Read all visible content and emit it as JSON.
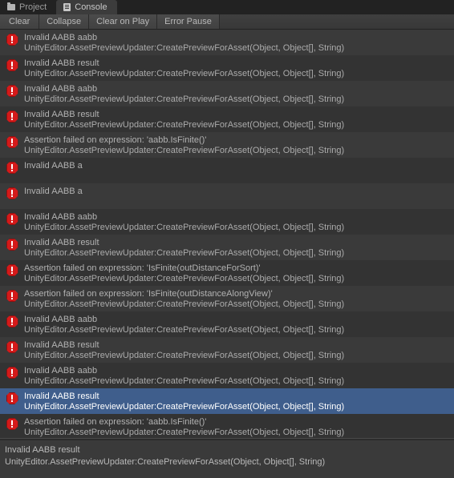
{
  "window": {
    "tabs": [
      {
        "label": "Project",
        "icon": "folder-icon",
        "active": false
      },
      {
        "label": "Console",
        "icon": "console-icon",
        "active": true
      }
    ]
  },
  "toolbar": {
    "buttons": [
      {
        "label": "Clear"
      },
      {
        "label": "Collapse"
      },
      {
        "label": "Clear on Play"
      },
      {
        "label": "Error Pause"
      }
    ]
  },
  "colors": {
    "window_bg": "#383838",
    "tabbar_bg": "#222222",
    "row_even": "#3a3a3a",
    "row_odd": "#333333",
    "selection": "#3f5e8c",
    "error_icon": "#d41a1a",
    "text": "#b2b2b2",
    "selected_text": "#ffffff"
  },
  "console": {
    "entries": [
      {
        "icon": "error-icon",
        "message": "Invalid AABB aabb",
        "stacktrace": "UnityEditor.AssetPreviewUpdater:CreatePreviewForAsset(Object, Object[], String)",
        "selected": false
      },
      {
        "icon": "error-icon",
        "message": "Invalid AABB result",
        "stacktrace": "UnityEditor.AssetPreviewUpdater:CreatePreviewForAsset(Object, Object[], String)",
        "selected": false
      },
      {
        "icon": "error-icon",
        "message": "Invalid AABB aabb",
        "stacktrace": "UnityEditor.AssetPreviewUpdater:CreatePreviewForAsset(Object, Object[], String)",
        "selected": false
      },
      {
        "icon": "error-icon",
        "message": "Invalid AABB result",
        "stacktrace": "UnityEditor.AssetPreviewUpdater:CreatePreviewForAsset(Object, Object[], String)",
        "selected": false
      },
      {
        "icon": "error-icon",
        "message": "Assertion failed on expression: 'aabb.IsFinite()'",
        "stacktrace": "UnityEditor.AssetPreviewUpdater:CreatePreviewForAsset(Object, Object[], String)",
        "selected": false
      },
      {
        "icon": "error-icon",
        "message": "Invalid AABB a",
        "stacktrace": "",
        "selected": false
      },
      {
        "icon": "error-icon",
        "message": "Invalid AABB a",
        "stacktrace": "",
        "selected": false
      },
      {
        "icon": "error-icon",
        "message": "Invalid AABB aabb",
        "stacktrace": "UnityEditor.AssetPreviewUpdater:CreatePreviewForAsset(Object, Object[], String)",
        "selected": false
      },
      {
        "icon": "error-icon",
        "message": "Invalid AABB result",
        "stacktrace": "UnityEditor.AssetPreviewUpdater:CreatePreviewForAsset(Object, Object[], String)",
        "selected": false
      },
      {
        "icon": "error-icon",
        "message": "Assertion failed on expression: 'IsFinite(outDistanceForSort)'",
        "stacktrace": "UnityEditor.AssetPreviewUpdater:CreatePreviewForAsset(Object, Object[], String)",
        "selected": false
      },
      {
        "icon": "error-icon",
        "message": "Assertion failed on expression: 'IsFinite(outDistanceAlongView)'",
        "stacktrace": "UnityEditor.AssetPreviewUpdater:CreatePreviewForAsset(Object, Object[], String)",
        "selected": false
      },
      {
        "icon": "error-icon",
        "message": "Invalid AABB aabb",
        "stacktrace": "UnityEditor.AssetPreviewUpdater:CreatePreviewForAsset(Object, Object[], String)",
        "selected": false
      },
      {
        "icon": "error-icon",
        "message": "Invalid AABB result",
        "stacktrace": "UnityEditor.AssetPreviewUpdater:CreatePreviewForAsset(Object, Object[], String)",
        "selected": false
      },
      {
        "icon": "error-icon",
        "message": "Invalid AABB aabb",
        "stacktrace": "UnityEditor.AssetPreviewUpdater:CreatePreviewForAsset(Object, Object[], String)",
        "selected": false
      },
      {
        "icon": "error-icon",
        "message": "Invalid AABB result",
        "stacktrace": "UnityEditor.AssetPreviewUpdater:CreatePreviewForAsset(Object, Object[], String)",
        "selected": true
      },
      {
        "icon": "error-icon",
        "message": "Assertion failed on expression: 'aabb.IsFinite()'",
        "stacktrace": "UnityEditor.AssetPreviewUpdater:CreatePreviewForAsset(Object, Object[], String)",
        "selected": false
      }
    ]
  },
  "detail": {
    "message": "Invalid AABB result",
    "stacktrace": "UnityEditor.AssetPreviewUpdater:CreatePreviewForAsset(Object, Object[], String)"
  }
}
